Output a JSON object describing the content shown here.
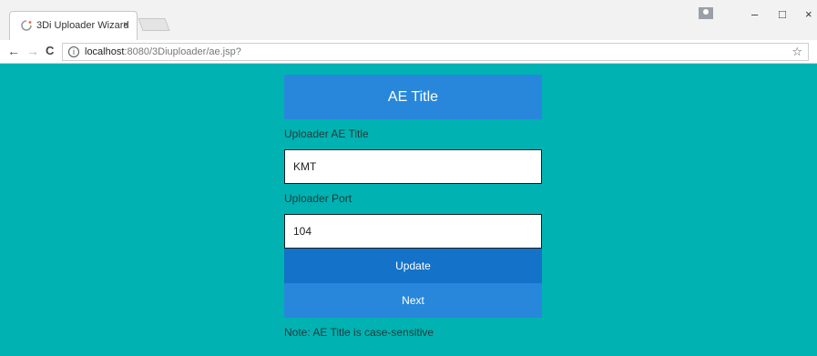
{
  "browser": {
    "tab_title": "3Di Uploader Wizard",
    "tab_close": "×",
    "url_host": "localhost",
    "url_path": ":8080/3Diuploader/ae.jsp?",
    "back": "←",
    "forward": "→",
    "reload": "C",
    "info": "i",
    "star": "☆",
    "minimize": "–",
    "maximize": "□",
    "close": "×"
  },
  "form": {
    "header": "AE Title",
    "ae_title_label": "Uploader AE Title",
    "ae_title_value": "KMT",
    "port_label": "Uploader Port",
    "port_value": "104",
    "update_label": "Update",
    "next_label": "Next",
    "note": "Note: AE Title is case-sensitive"
  },
  "colors": {
    "page_background": "#00b2b2",
    "header_background": "#2987db",
    "update_background": "#1472c8",
    "next_background": "#2987db"
  }
}
